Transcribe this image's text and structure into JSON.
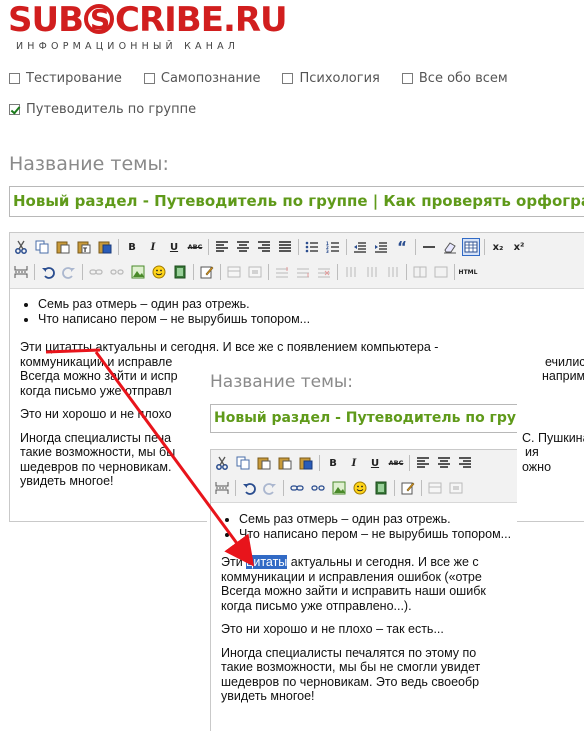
{
  "logo": {
    "text_left": "SUB",
    "text_right": "CRIBE.RU",
    "tagline": "ИНФОРМАЦИОННЫЙ КАНАЛ"
  },
  "categories": [
    {
      "label": "Тестирование",
      "checked": false
    },
    {
      "label": "Самопознание",
      "checked": false
    },
    {
      "label": "Психология",
      "checked": false
    },
    {
      "label": "Все обо всем",
      "checked": false
    },
    {
      "label": "Путеводитель по группе",
      "checked": true
    }
  ],
  "theme": {
    "label": "Название темы:",
    "value": "Новый раздел - Путеводитель по группе | Как проверять орфографию"
  },
  "toolbar": {
    "bold": "B",
    "italic": "I",
    "underline": "U",
    "strike": "ABC",
    "quote": "“",
    "subscript": "x₂",
    "superscript": "x²",
    "html": "HTML"
  },
  "content": {
    "bullets": [
      "Семь раз отмерь – один раз отрежь.",
      "Что написано пером – не вырубишь топором..."
    ],
    "main": {
      "p1_before": "Эти ",
      "p1_word": "цитатты",
      "p1_after": " актуальны и сегодня. И все же с появлением компьютера -",
      "p1_line2": "коммуникации и исправле",
      "p1_line2_end": "ечились.",
      "p1_line3": "Всегда можно зайти и испр",
      "p1_line3_end": "например,",
      "p1_line4": "когда письмо уже отправл",
      "p2": "Это ни хорошо и не плохо",
      "p3_line1": "Иногда специалисты печа",
      "p3_line1_end": "С. Пушкина",
      "p3_line2": "такие возможности, мы бы",
      "p3_line2_end": "ия",
      "p3_line3": "шедевров по черновикам.",
      "p3_line3_end": "ожно",
      "p3_line4": "увидеть многое!"
    },
    "zoom": {
      "p1_before": "Эти ",
      "p1_word": "цитаты",
      "p1_after": " актуальны и сегодня. И все же с",
      "p1_line2": "коммуникации и исправления ошибок («отре",
      "p1_line3": "Всегда можно зайти и исправить наши ошибк",
      "p1_line4": "когда письмо уже отправлено...).",
      "p2": "Это ни хорошо и не плохо – так есть...",
      "p3_line1": "Иногда специалисты печалятся по этому по",
      "p3_line2": "такие возможности, мы бы не смогли увидет",
      "p3_line3": "шедевров по черновикам. Это ведь своеобр",
      "p3_line4": "увидеть многое!"
    }
  },
  "colors": {
    "logo": "#d11e1e",
    "title": "#5f9a1a",
    "arrow": "#e8141b",
    "highlight": "#316ac5"
  }
}
